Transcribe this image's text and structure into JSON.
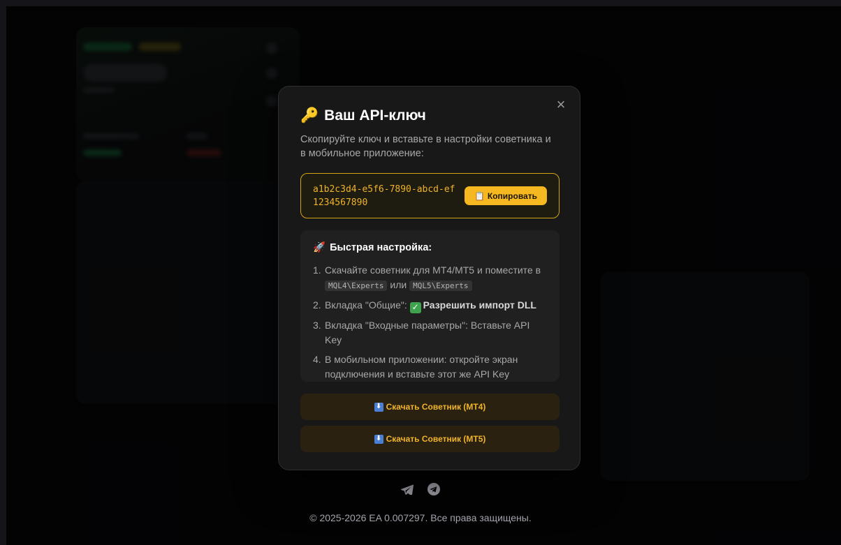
{
  "modal": {
    "title": "Ваш API-ключ",
    "title_icon": "key-icon",
    "close_label": "×",
    "subtitle": "Скопируйте ключ и вставьте в настройки советника и в мобильное приложение:",
    "api_key": "a1b2c3d4-e5f6-7890-abcd-ef1234567890",
    "copy_label": "Копировать",
    "copy_icon": "clipboard-icon",
    "setup": {
      "title": "Быстрая настройка:",
      "title_icon": "rocket-icon",
      "steps": [
        {
          "num": "1.",
          "text_a": "Скачайте советник для MT4/MT5 и поместите в",
          "code_a": "MQL4\\Experts",
          "text_b": "или",
          "code_b": "MQL5\\Experts"
        },
        {
          "num": "2.",
          "text_a": "Вкладка \"Общие\":",
          "strong": "Разрешить импорт DLL"
        },
        {
          "num": "3.",
          "text_a": "Вкладка \"Входные параметры\": Вставьте API Key"
        },
        {
          "num": "4.",
          "text_a": "В мобильном приложении: откройте экран подключения и вставьте этот же API Key"
        }
      ]
    },
    "download_mt4": "Скачать Советник (MT4)",
    "download_mt5": "Скачать Советник (MT5)",
    "download_icon": "download-arrow-icon"
  },
  "footer": {
    "icons": [
      "telegram-plane-icon",
      "telegram-circle-icon"
    ],
    "copyright": "© 2025-2026 EA 0.007297. Все права защищены."
  },
  "colors": {
    "accent": "#f5b820",
    "modal_bg": "#181818",
    "page_bg": "#050507"
  }
}
